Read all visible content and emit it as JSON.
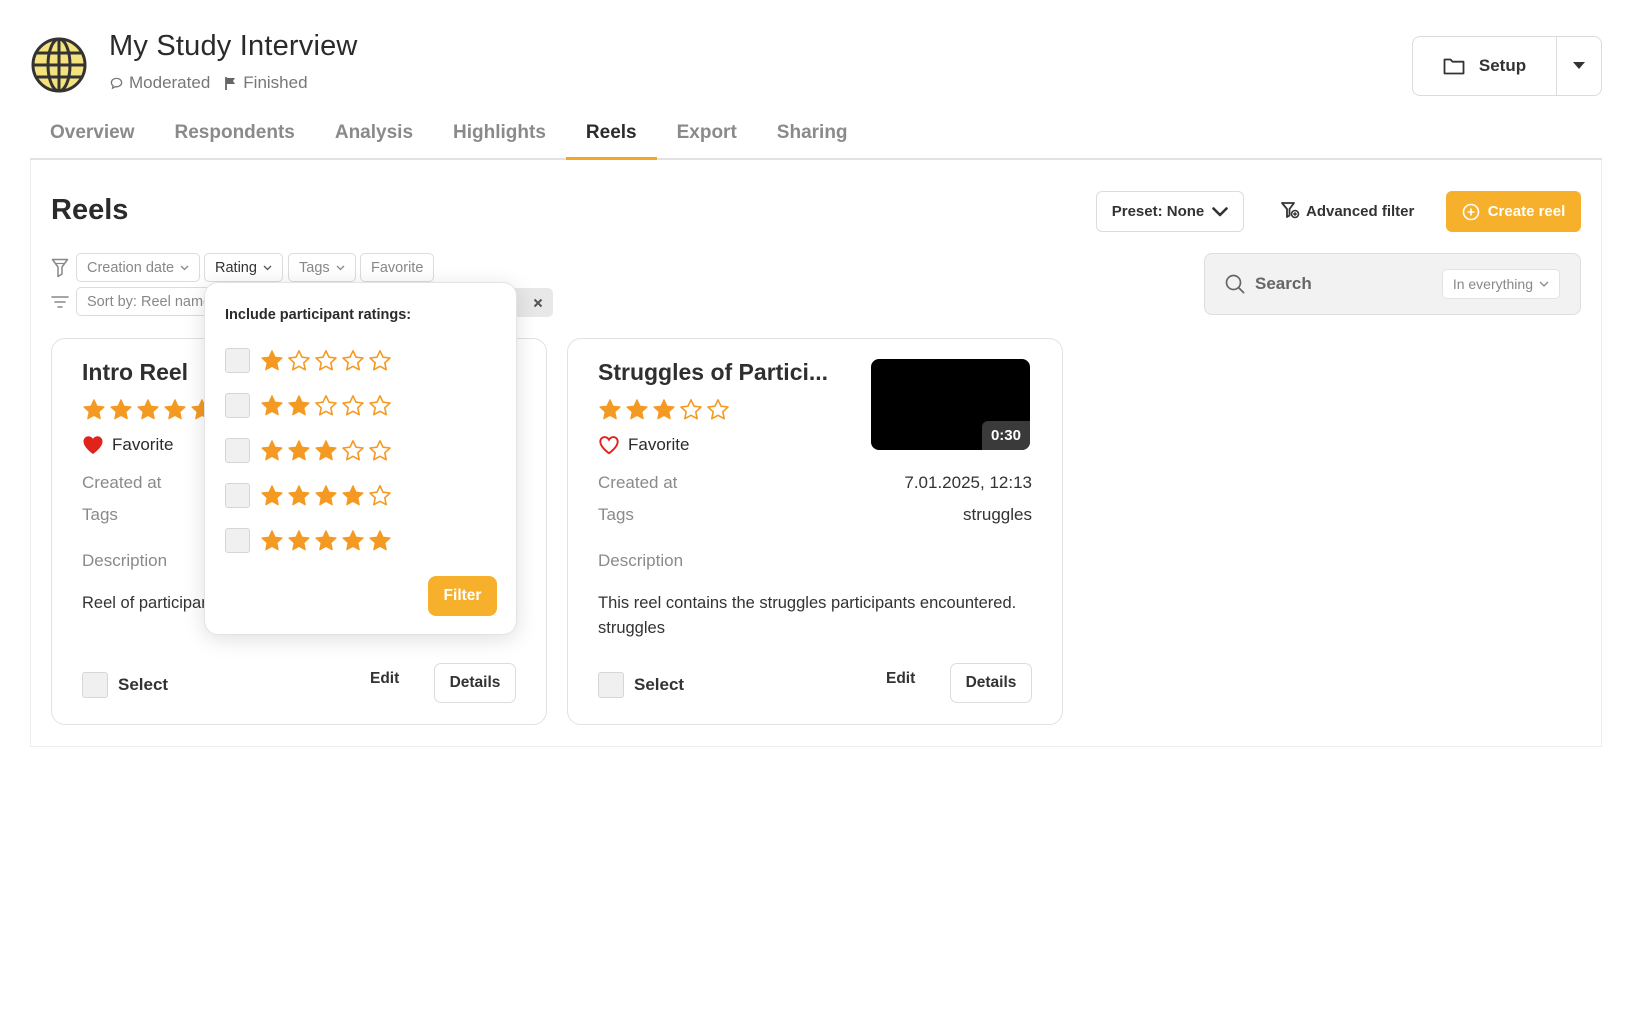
{
  "study": {
    "title": "My Study Interview",
    "mode": "Moderated",
    "status": "Finished"
  },
  "header": {
    "setup_label": "Setup"
  },
  "tabs": [
    {
      "label": "Overview",
      "active": false
    },
    {
      "label": "Respondents",
      "active": false
    },
    {
      "label": "Analysis",
      "active": false
    },
    {
      "label": "Highlights",
      "active": false
    },
    {
      "label": "Reels",
      "active": true
    },
    {
      "label": "Export",
      "active": false
    },
    {
      "label": "Sharing",
      "active": false
    }
  ],
  "page": {
    "title": "Reels",
    "preset_label": "Preset: None",
    "advanced_filter_label": "Advanced filter",
    "create_reel_label": "Create reel"
  },
  "search": {
    "label": "Search",
    "scope": "In everything"
  },
  "filters": {
    "chips": [
      "Creation date",
      "Rating",
      "Tags",
      "Favorite"
    ],
    "sort_label": "Sort by: Reel name",
    "active_tag_fragment": "l"
  },
  "rating_popover": {
    "title": "Include participant ratings:",
    "options": [
      1,
      2,
      3,
      4,
      5
    ],
    "filter_label": "Filter"
  },
  "cards": [
    {
      "title": "Intro Reel",
      "rating": 5,
      "favorite": true,
      "favorite_label": "Favorite",
      "created_label": "Created at",
      "tags_label": "Tags",
      "description_label": "Description",
      "description": "Reel of participants",
      "select_label": "Select",
      "edit_label": "Edit",
      "details_label": "Details"
    },
    {
      "title": "Struggles of Partici...",
      "rating": 3,
      "favorite": false,
      "favorite_label": "Favorite",
      "created_label": "Created at",
      "created_value": "7.01.2025, 12:13",
      "tags_label": "Tags",
      "tags_value": "struggles",
      "description_label": "Description",
      "description": "This reel contains the struggles participants encountered. struggles",
      "duration": "0:30",
      "select_label": "Select",
      "edit_label": "Edit",
      "details_label": "Details"
    }
  ],
  "colors": {
    "accent": "#f7b02c",
    "star": "#f49a22",
    "favorite": "#e0231b",
    "globe": "#f3e27e"
  }
}
